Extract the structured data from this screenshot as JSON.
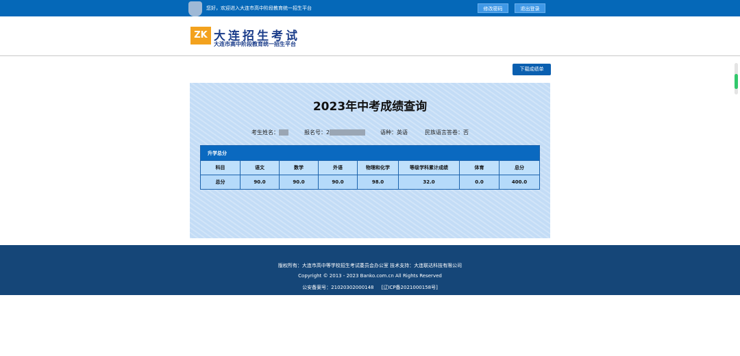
{
  "topbar": {
    "welcome": "您好，欢迎进入大连市高中阶段教育统一招生平台",
    "change_password": "修改密码",
    "logout": "退出登录"
  },
  "logo": {
    "title": "大连招生考试",
    "subtitle": "大连市高中阶段教育统一招生平台",
    "mark": "ZK"
  },
  "download_button": "下载成绩单",
  "card": {
    "title": "2023年中考成绩查询",
    "name_label": "考生姓名：",
    "reg_label": "报名号：",
    "reg_prefix": "2",
    "lang_label": "语种：",
    "lang_value": "英语",
    "ethnic_label": "民族语言答卷：",
    "ethnic_value": "否",
    "table_title": "升学总分",
    "headers": [
      "科目",
      "语文",
      "数学",
      "外语",
      "物理和化学",
      "等级学科累计成绩",
      "体育",
      "总分"
    ],
    "row": [
      "总分",
      "90.0",
      "90.0",
      "90.0",
      "98.0",
      "32.0",
      "0.0",
      "400.0"
    ]
  },
  "footer": {
    "line1": "版权所有：大连市高中等学校招生考试委员会办公室  技术支持：大连联达科技有限公司",
    "line2": "Copyright © 2013 - 2023 Banko.com.cn All Rights Reserved",
    "line3a": "公安备案号：21020302000148",
    "line3b": "[辽ICP备2021000158号]"
  }
}
